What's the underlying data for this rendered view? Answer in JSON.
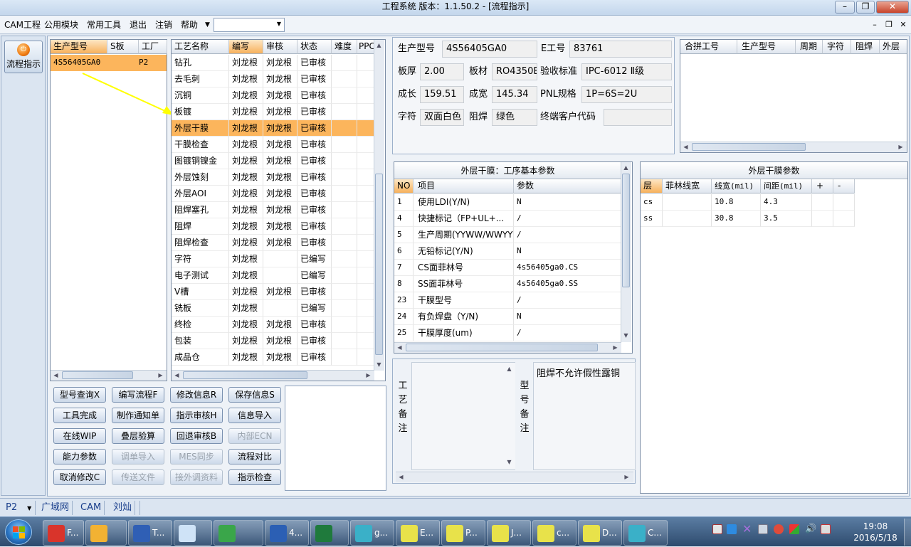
{
  "titlebar": {
    "title": "工程系统   版本：1.1.50.2 - [流程指示]"
  },
  "menu": {
    "items": [
      "CAM工程",
      "公用模块",
      "常用工具",
      "退出",
      "注销",
      "帮助"
    ]
  },
  "left_nav": {
    "flow_label": "流程指示"
  },
  "model_list": {
    "headers": [
      "生产型号",
      "S板",
      "工厂"
    ],
    "rows": [
      [
        "4S56405GA0",
        "",
        "P2"
      ]
    ]
  },
  "process_list": {
    "headers": [
      "工艺名称",
      "编写",
      "审核",
      "状态",
      "难度",
      "PPC"
    ],
    "rows": [
      [
        "钻孔",
        "刘龙根",
        "刘龙根",
        "已审核"
      ],
      [
        "去毛刺",
        "刘龙根",
        "刘龙根",
        "已审核"
      ],
      [
        "沉铜",
        "刘龙根",
        "刘龙根",
        "已审核"
      ],
      [
        "板镀",
        "刘龙根",
        "刘龙根",
        "已审核"
      ],
      [
        "外层干膜",
        "刘龙根",
        "刘龙根",
        "已审核"
      ],
      [
        "干膜检查",
        "刘龙根",
        "刘龙根",
        "已审核"
      ],
      [
        "图镀铜镍金",
        "刘龙根",
        "刘龙根",
        "已审核"
      ],
      [
        "外层蚀刻",
        "刘龙根",
        "刘龙根",
        "已审核"
      ],
      [
        "外层AOI",
        "刘龙根",
        "刘龙根",
        "已审核"
      ],
      [
        "阻焊塞孔",
        "刘龙根",
        "刘龙根",
        "已审核"
      ],
      [
        "阻焊",
        "刘龙根",
        "刘龙根",
        "已审核"
      ],
      [
        "阻焊检查",
        "刘龙根",
        "刘龙根",
        "已审核"
      ],
      [
        "字符",
        "刘龙根",
        "",
        "已编写"
      ],
      [
        "电子测试",
        "刘龙根",
        "",
        "已编写"
      ],
      [
        "V槽",
        "刘龙根",
        "刘龙根",
        "已审核"
      ],
      [
        "铣板",
        "刘龙根",
        "",
        "已编写"
      ],
      [
        "终检",
        "刘龙根",
        "刘龙根",
        "已审核"
      ],
      [
        "包装",
        "刘龙根",
        "刘龙根",
        "已审核"
      ],
      [
        "成品仓",
        "刘龙根",
        "刘龙根",
        "已审核"
      ]
    ],
    "selected_index": 4
  },
  "buttons": [
    [
      "型号查询X",
      "编写流程F",
      "修改信息R",
      "保存信息S"
    ],
    [
      "工具完成",
      "制作通知单",
      "指示审核H",
      "信息导入"
    ],
    [
      "在线WIP",
      "叠层验算",
      "回退审核B",
      "内部ECN"
    ],
    [
      "能力参数",
      "调单导入",
      "MES同步",
      "流程对比"
    ],
    [
      "取消修改C",
      "传送文件",
      "接外调资料",
      "指示检查"
    ]
  ],
  "disabled_buttons": [
    "内部ECN",
    "调单导入",
    "MES同步",
    "传送文件",
    "接外调资料"
  ],
  "info": {
    "model_label": "生产型号",
    "model_value": "4S56405GA0",
    "eno_label": "E工号",
    "eno_value": "83761",
    "thick_label": "板厚",
    "thick_value": "2.00",
    "material_label": "板材",
    "material_value": "RO4350E",
    "std_label": "验收标准",
    "std_value": "IPC-6012 Ⅱ级",
    "length_label": "成长",
    "length_value": "159.51",
    "width_label": "成宽",
    "width_value": "145.34",
    "pnl_label": "PNL规格",
    "pnl_value": "1P=6S=2U",
    "char_label": "字符",
    "char_value": "双面白色",
    "solder_label": "阻焊",
    "solder_value": "绿色",
    "client_label": "终端客户代码",
    "client_value": ""
  },
  "merge_table": {
    "headers": [
      "合拼工号",
      "生产型号",
      "周期",
      "字符",
      "阻焊",
      "外层"
    ]
  },
  "basic_params": {
    "title": "外层干膜：工序基本参数",
    "headers": [
      "NO",
      "项目",
      "参数"
    ],
    "rows": [
      [
        "1",
        "使用LDI(Y/N)",
        "N"
      ],
      [
        "4",
        "快捷标记（FP+UL+...",
        "/"
      ],
      [
        "5",
        "生产周期(YYWW/WWYY)",
        "/"
      ],
      [
        "6",
        "无铅标记(Y/N)",
        "N"
      ],
      [
        "7",
        "CS面菲林号",
        "4s56405ga0.CS"
      ],
      [
        "8",
        "SS面菲林号",
        "4s56405ga0.SS"
      ],
      [
        "23",
        "干膜型号",
        "/"
      ],
      [
        "24",
        "有负焊盘（Y/N)",
        "N"
      ],
      [
        "25",
        "干膜厚度(um)",
        "/"
      ]
    ]
  },
  "dryfilm_params": {
    "title": "外层干膜参数",
    "headers": [
      "层",
      "菲林线宽",
      "线宽(mil)",
      "间距(mil)",
      "+",
      "-"
    ],
    "rows": [
      [
        "cs",
        "",
        "10.8",
        "4.3",
        "",
        ""
      ],
      [
        "ss",
        "",
        "30.8",
        "3.5",
        "",
        ""
      ]
    ]
  },
  "notes": {
    "process_label": "工艺备注",
    "process_text": "",
    "model_label": "型号备注",
    "model_text": "阻焊不允许假性露铜"
  },
  "status": {
    "factory": "P2",
    "segments": [
      "广域网",
      "CAM",
      "刘灿"
    ]
  },
  "taskbar": {
    "tasks": [
      {
        "icon": "foxit-icon",
        "label": "F..."
      },
      {
        "icon": "shell-icon",
        "label": ""
      },
      {
        "icon": "floppy-icon",
        "label": "T..."
      },
      {
        "icon": "notepad-icon",
        "label": ""
      },
      {
        "icon": "p-app-icon",
        "label": ""
      },
      {
        "icon": "word-icon",
        "label": "4..."
      },
      {
        "icon": "excel-icon",
        "label": ""
      },
      {
        "icon": "eye-app-icon",
        "label": "g..."
      },
      {
        "icon": "x-window-icon",
        "label": "E..."
      },
      {
        "icon": "x-window-icon",
        "label": "P..."
      },
      {
        "icon": "x-window-icon",
        "label": "J..."
      },
      {
        "icon": "x-window-icon",
        "label": "c..."
      },
      {
        "icon": "x-window-icon",
        "label": "D..."
      },
      {
        "icon": "eye-app-icon",
        "label": "C..."
      }
    ],
    "time": "19:08",
    "date": "2016/5/18"
  },
  "colors": {
    "selected_row": "#fcb55c",
    "accent_header": "#f7b15c"
  }
}
